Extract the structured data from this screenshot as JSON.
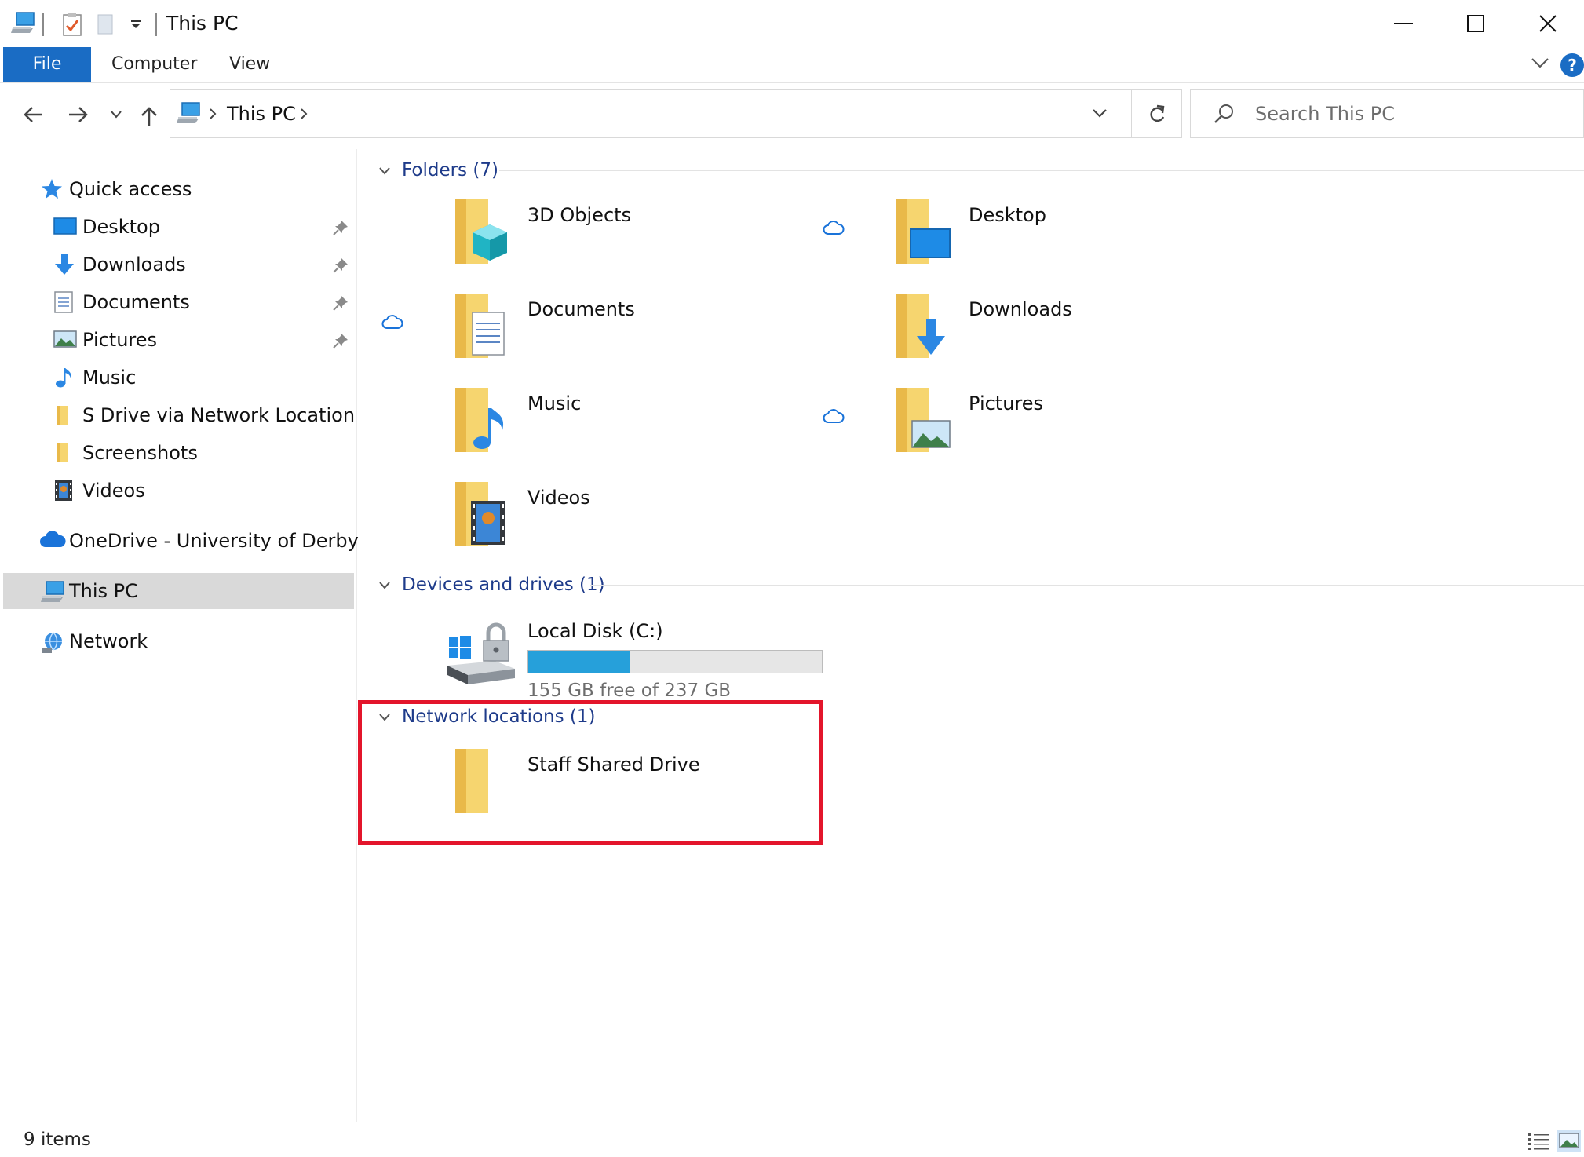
{
  "window": {
    "title": "This PC"
  },
  "ribbon": {
    "tabs": [
      "File",
      "Computer",
      "View"
    ],
    "help_label": "?"
  },
  "address": {
    "path": "This PC",
    "search_placeholder": "Search This PC"
  },
  "nav": {
    "quick_access": "Quick access",
    "quick_items": [
      {
        "label": "Desktop",
        "icon": "desktop-icon",
        "pinned": true
      },
      {
        "label": "Downloads",
        "icon": "downloads-icon",
        "pinned": true
      },
      {
        "label": "Documents",
        "icon": "documents-icon",
        "pinned": true
      },
      {
        "label": "Pictures",
        "icon": "pictures-icon",
        "pinned": true
      },
      {
        "label": "Music",
        "icon": "music-icon",
        "pinned": false
      },
      {
        "label": "S Drive via Network Location",
        "icon": "folder-icon",
        "pinned": false
      },
      {
        "label": "Screenshots",
        "icon": "folder-icon",
        "pinned": false
      },
      {
        "label": "Videos",
        "icon": "videos-icon",
        "pinned": false
      }
    ],
    "onedrive": "OneDrive - University of Derby",
    "this_pc": "This PC",
    "network": "Network"
  },
  "content": {
    "folders_header": "Folders (7)",
    "folders": [
      {
        "label": "3D Objects",
        "icon": "3d-objects-folder-icon",
        "cloud": false
      },
      {
        "label": "Desktop",
        "icon": "desktop-folder-icon",
        "cloud": true
      },
      {
        "label": "Documents",
        "icon": "documents-folder-icon",
        "cloud": true
      },
      {
        "label": "Downloads",
        "icon": "downloads-folder-icon",
        "cloud": false
      },
      {
        "label": "Music",
        "icon": "music-folder-icon",
        "cloud": false
      },
      {
        "label": "Pictures",
        "icon": "pictures-folder-icon",
        "cloud": true
      },
      {
        "label": "Videos",
        "icon": "videos-folder-icon",
        "cloud": false
      }
    ],
    "devices_header": "Devices and drives (1)",
    "drive": {
      "label": "Local Disk (C:)",
      "free_text": "155 GB free of 237 GB",
      "used_fraction": 0.346
    },
    "network_header": "Network locations (1)",
    "network_locations": [
      {
        "label": "Staff Shared Drive",
        "icon": "network-folder-icon"
      }
    ]
  },
  "status": {
    "item_count": "9 items"
  },
  "colors": {
    "accent": "#1a6cc4",
    "group_header_text": "#1e3b8a",
    "highlight": "#e3152b",
    "drive_bar": "#26a0da"
  }
}
